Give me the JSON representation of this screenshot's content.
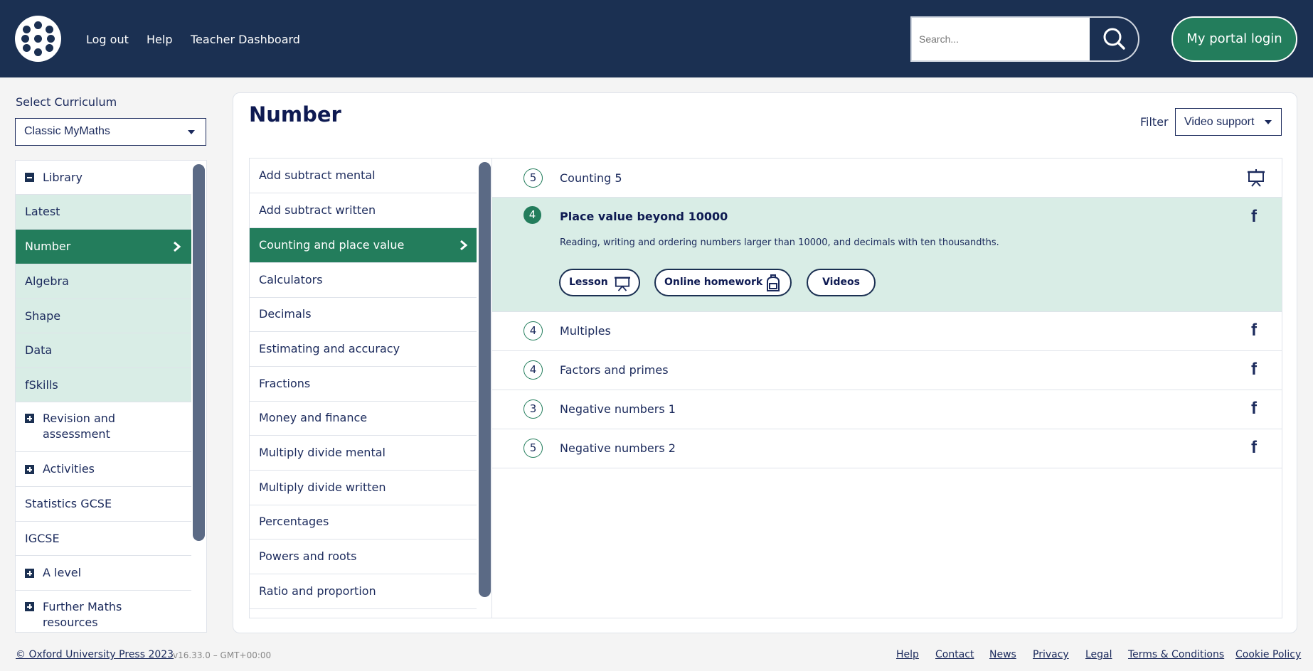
{
  "header": {
    "nav": [
      "Log out",
      "Help",
      "Teacher Dashboard"
    ],
    "search_placeholder": "Search...",
    "portal_button": "My portal login",
    "brand_color": "#1b3052",
    "accent_color": "#237d5c"
  },
  "sidebar": {
    "curriculum_label": "Select Curriculum",
    "curriculum_value": "Classic MyMaths",
    "items": [
      {
        "label": "Library",
        "toggle": "minus"
      },
      {
        "label": "Latest"
      },
      {
        "label": "Number",
        "active": true
      },
      {
        "label": "Algebra"
      },
      {
        "label": "Shape"
      },
      {
        "label": "Data"
      },
      {
        "label": "fSkills"
      },
      {
        "label": "Revision and assessment",
        "toggle": "plus"
      },
      {
        "label": "Activities",
        "toggle": "plus"
      },
      {
        "label": "Statistics GCSE"
      },
      {
        "label": "IGCSE"
      },
      {
        "label": "A level",
        "toggle": "plus"
      },
      {
        "label": "Further Maths resources",
        "toggle": "plus"
      }
    ]
  },
  "main": {
    "title": "Number",
    "filter_label": "Filter",
    "filter_value": "Video support",
    "topics": [
      "Add subtract mental",
      "Add subtract written",
      "Counting and place value",
      "Calculators",
      "Decimals",
      "Estimating and accuracy",
      "Fractions",
      "Money and finance",
      "Multiply divide mental",
      "Multiply divide written",
      "Percentages",
      "Powers and roots",
      "Ratio and proportion"
    ],
    "active_topic": "Counting and place value",
    "lessons": [
      {
        "level": "5",
        "title": "Counting 5",
        "icon": "presentation-icon"
      },
      {
        "level": "4",
        "title": "Place value beyond 10000",
        "description": "Reading, writing and ordering numbers larger than 10000, and decimals with ten thousandths.",
        "badge": "f",
        "expanded": true,
        "buttons": [
          "Lesson",
          "Online homework",
          "Videos"
        ]
      },
      {
        "level": "4",
        "title": "Multiples",
        "badge": "f"
      },
      {
        "level": "4",
        "title": "Factors and primes",
        "badge": "f"
      },
      {
        "level": "3",
        "title": "Negative numbers 1",
        "badge": "f"
      },
      {
        "level": "5",
        "title": "Negative numbers 2",
        "badge": "f"
      }
    ]
  },
  "footer": {
    "copyright": "© Oxford University Press 2023",
    "version": "v16.33.0 – GMT+00:00",
    "links": [
      "Help",
      "Contact",
      "News",
      "Privacy",
      "Legal",
      "Terms & Conditions",
      "Cookie Policy"
    ]
  }
}
